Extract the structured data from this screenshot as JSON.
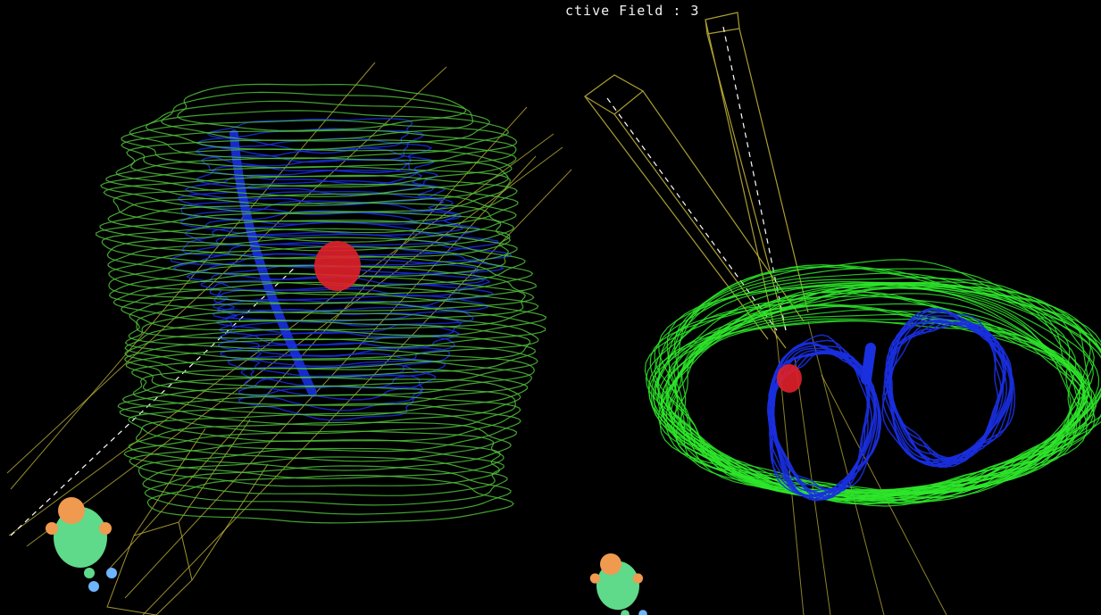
{
  "header": {
    "active_field_text": "ctive Field : 3"
  },
  "colors": {
    "background": "#000000",
    "body_contour": "#4fbf3a",
    "body_contour_bright": "#2ee82a",
    "lung": "#1a2fe0",
    "target": "#e0202a",
    "beam": "#c8b93a",
    "beam_axis": "#ffffff",
    "manikin_body": "#5fd98a",
    "manikin_head": "#f09a50",
    "manikin_feet": "#6fb4ff"
  },
  "views": [
    {
      "name": "left-3d-view",
      "icon": "patient-orientation-manikin-icon"
    },
    {
      "name": "right-3d-view",
      "icon": "patient-orientation-manikin-icon"
    }
  ]
}
